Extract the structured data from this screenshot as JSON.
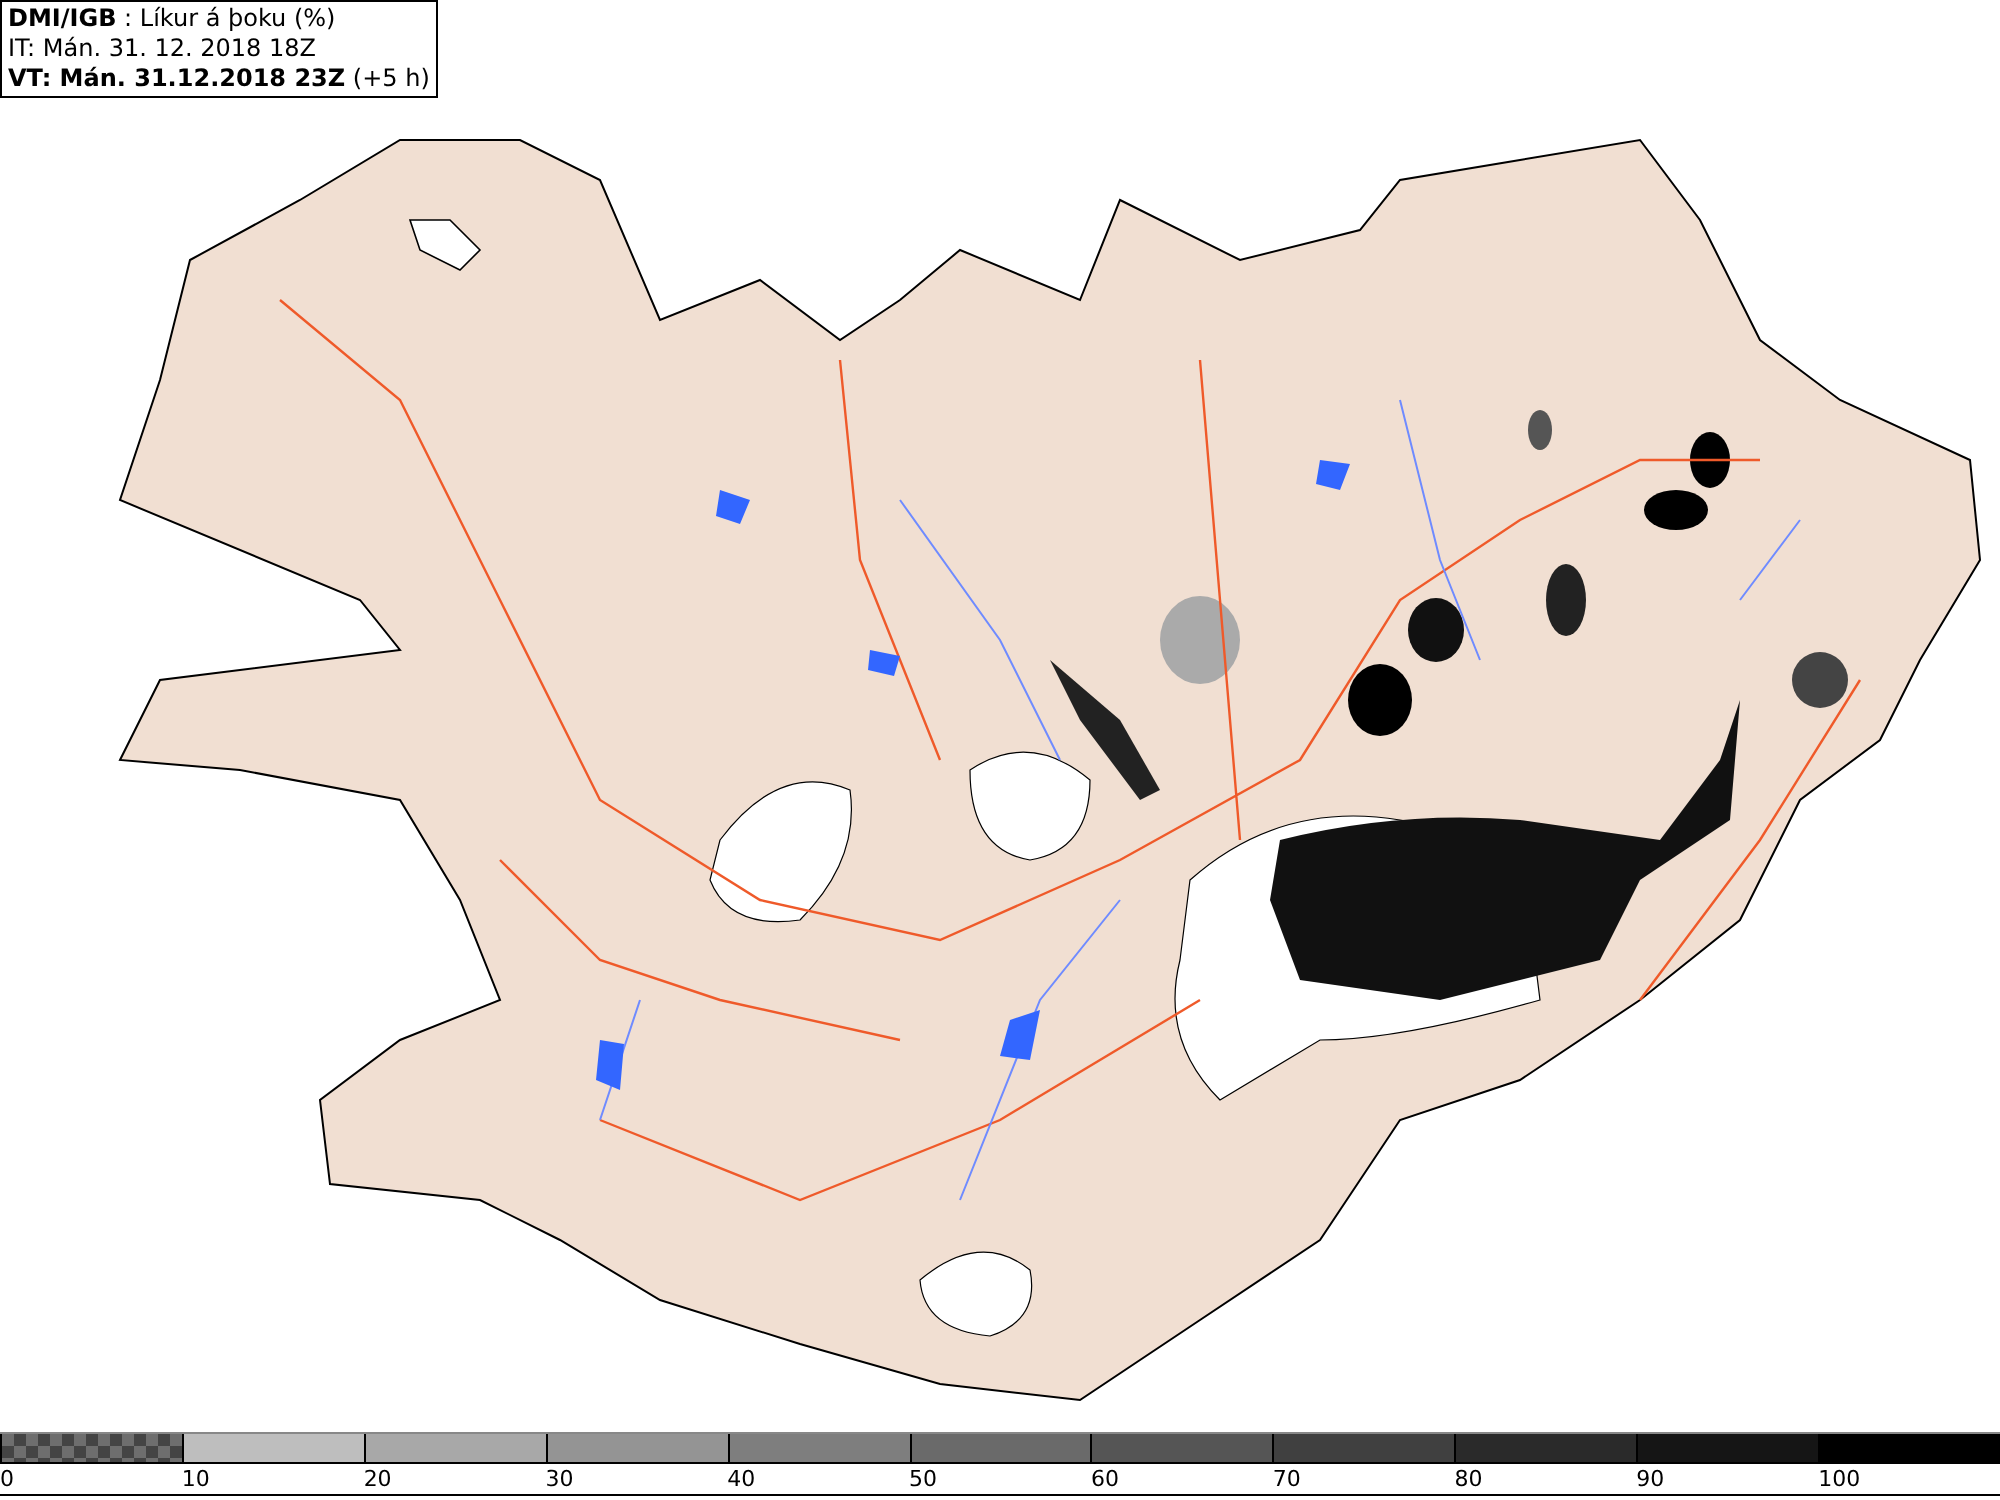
{
  "header": {
    "lines": [
      "**DMI/IGB** : Líkur á þoku (%)",
      "IT: Mán. 31. 12. 2018 18Z",
      "**VT: Mán. 31.12.2018 23Z** (+5 h)"
    ]
  },
  "legend": {
    "items": [
      {
        "label": "0",
        "kind": "checker",
        "color": "#6e6e6e"
      },
      {
        "label": "10",
        "kind": "solid",
        "color": "#bebebe"
      },
      {
        "label": "20",
        "kind": "solid",
        "color": "#a8a8a8"
      },
      {
        "label": "30",
        "kind": "solid",
        "color": "#949494"
      },
      {
        "label": "40",
        "kind": "solid",
        "color": "#7e7e7e"
      },
      {
        "label": "50",
        "kind": "solid",
        "color": "#6a6a6a"
      },
      {
        "label": "60",
        "kind": "solid",
        "color": "#555555"
      },
      {
        "label": "70",
        "kind": "solid",
        "color": "#404040"
      },
      {
        "label": "80",
        "kind": "solid",
        "color": "#2a2a2a"
      },
      {
        "label": "90",
        "kind": "solid",
        "color": "#151515"
      },
      {
        "label": "100",
        "kind": "solid",
        "color": "#000000"
      }
    ]
  }
}
